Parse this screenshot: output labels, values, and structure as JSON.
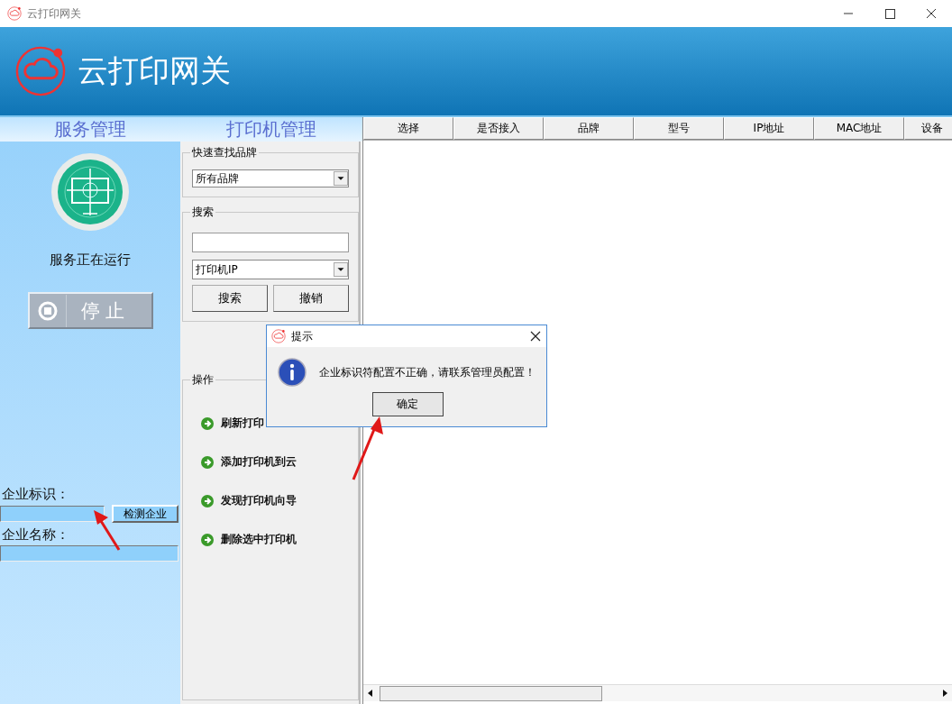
{
  "window": {
    "title": "云打印网关"
  },
  "header": {
    "app_name": "云打印网关"
  },
  "tabs": [
    "服务管理",
    "打印机管理"
  ],
  "service": {
    "status": "服务正在运行",
    "stop_button": "停 止"
  },
  "enterprise": {
    "id_label": "企业标识：",
    "check_button": "检测企业",
    "name_label": "企业名称："
  },
  "brand_filter": {
    "title": "快速查找品牌",
    "value": "所有品牌"
  },
  "search": {
    "title": "搜索",
    "type": "打印机IP",
    "buttons": [
      "搜索",
      "撤销"
    ]
  },
  "operations": {
    "title": "操作",
    "items": [
      "刷新打印",
      "添加打印机到云",
      "发现打印机向导",
      "删除选中打印机"
    ]
  },
  "table": {
    "columns": [
      "选择",
      "是否接入",
      "品牌",
      "型号",
      "IP地址",
      "MAC地址",
      "设备"
    ]
  },
  "dialog": {
    "title": "提示",
    "message": "企业标识符配置不正确，请联系管理员配置！",
    "button": "确定"
  }
}
